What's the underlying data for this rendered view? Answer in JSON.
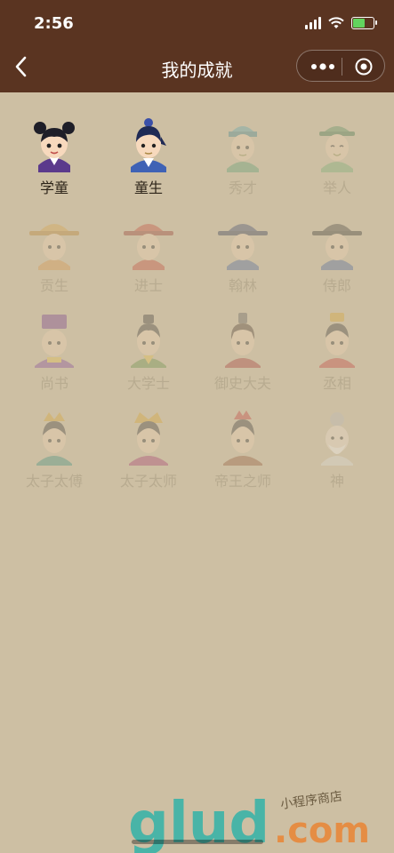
{
  "status_bar": {
    "time": "2:56"
  },
  "nav": {
    "title": "我的成就"
  },
  "achievements": [
    {
      "name": "学童",
      "unlocked": true
    },
    {
      "name": "童生",
      "unlocked": true
    },
    {
      "name": "秀才",
      "unlocked": false
    },
    {
      "name": "举人",
      "unlocked": false
    },
    {
      "name": "贡生",
      "unlocked": false
    },
    {
      "name": "进士",
      "unlocked": false
    },
    {
      "name": "翰林",
      "unlocked": false
    },
    {
      "name": "侍郎",
      "unlocked": false
    },
    {
      "name": "尚书",
      "unlocked": false
    },
    {
      "name": "大学士",
      "unlocked": false
    },
    {
      "name": "御史大夫",
      "unlocked": false
    },
    {
      "name": "丞相",
      "unlocked": false
    },
    {
      "name": "太子太傅",
      "unlocked": false
    },
    {
      "name": "太子太师",
      "unlocked": false
    },
    {
      "name": "帝王之师",
      "unlocked": false
    },
    {
      "name": "神",
      "unlocked": false
    }
  ],
  "watermark": {
    "brand": "glud",
    "suffix": ".com",
    "tagline": "小程序商店"
  },
  "colors": {
    "header": "#5a3421",
    "background": "#cdbfa3",
    "locked_text": "#b8ab90"
  }
}
